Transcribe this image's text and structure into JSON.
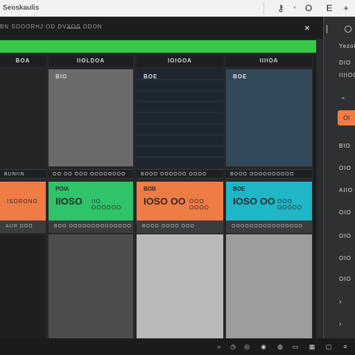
{
  "colors": {
    "accent_green": "#37c84a",
    "accent_orange": "#ef7b45",
    "accent_teal": "#1fb6c7",
    "background": "#2a2b2d"
  },
  "topbar": {
    "title": "Seoskaulis",
    "buttons": [
      "key-icon",
      "O",
      "E",
      "+"
    ]
  },
  "header": {
    "breadcrumb": "BN SOOORHJ OD DVXOS ODON",
    "close_label": "×"
  },
  "columns": [
    {
      "header": "BOA",
      "tag": "",
      "label": "BUNIIN",
      "card": {
        "tag": "",
        "big": "",
        "small": "ISORONO",
        "meta": "",
        "foot": "AUR DOO"
      }
    },
    {
      "header": "IIOLDOA",
      "tag": "BIO",
      "label": "OO OO OOO OOOOOOOO",
      "card": {
        "tag": "POIA",
        "big": "IIOSO",
        "small": "IIO  OOOOOO",
        "meta": "",
        "foot": "BOO OOOOOOOOOOOOOO"
      }
    },
    {
      "header": "IOIOOA",
      "tag": "BOE",
      "label": "BOOO OOOOOO OOOO",
      "card": {
        "tag": "BOB",
        "big": "IOSO OO",
        "small": "OOO OOOO",
        "meta": "",
        "foot": "BOOO OOOO OOO"
      }
    },
    {
      "header": "IIIIOA",
      "tag": "BOE",
      "label": "BOOO OOOOOOOOOO",
      "card": {
        "tag": "BOE",
        "big": "IOSO OO",
        "small": "OOO OOOOO",
        "meta": "",
        "foot": "OOOOOOOOOOOOOOOO"
      }
    }
  ],
  "sidebar": {
    "title": "Yezol",
    "items": [
      "DIO",
      "IIIIOOC",
      "BIO",
      "OIO",
      "AIIO",
      "OIO",
      "OIO",
      "OIO",
      "OIO"
    ],
    "accent_item": "OI",
    "chevron": "⌃"
  },
  "bottombar": {
    "icons": [
      "paperclip-icon",
      "clock-icon",
      "circle-icon",
      "globe-icon",
      "power-icon",
      "window-icon",
      "grid-icon",
      "square-icon"
    ]
  }
}
